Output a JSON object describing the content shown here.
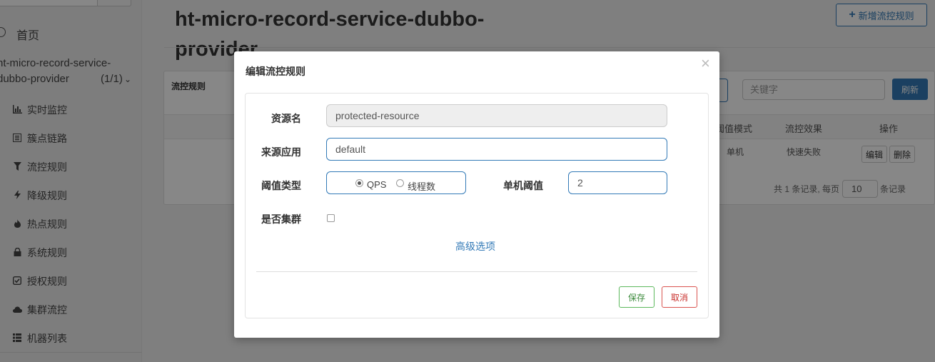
{
  "sidebar": {
    "home_label": "首页",
    "app_name_line1": "ht-micro-record-service-",
    "app_name_line2": "dubbo-provider",
    "app_count": "(1/1)",
    "items": [
      {
        "label": "实时监控",
        "icon": "bar-chart-icon"
      },
      {
        "label": "簇点链路",
        "icon": "list-icon"
      },
      {
        "label": "流控规则",
        "icon": "filter-icon"
      },
      {
        "label": "降级规则",
        "icon": "flash-icon"
      },
      {
        "label": "热点规则",
        "icon": "fire-icon"
      },
      {
        "label": "系统规则",
        "icon": "lock-icon"
      },
      {
        "label": "授权规则",
        "icon": "check-icon"
      },
      {
        "label": "集群流控",
        "icon": "cloud-icon"
      },
      {
        "label": "机器列表",
        "icon": "grid-icon"
      }
    ]
  },
  "page": {
    "title": "ht-micro-record-service-dubbo-provider",
    "add_button": "新增流控规则"
  },
  "panel": {
    "title": "流控规则",
    "keyword_placeholder": "关键字",
    "refresh_button": "刷新",
    "columns": {
      "threshold_mode": "阈值模式",
      "effect": "流控效果",
      "actions": "操作"
    },
    "row": {
      "threshold_mode": "单机",
      "effect": "快速失败",
      "edit": "编辑",
      "delete": "删除"
    },
    "pager": {
      "prefix": "共 1 条记录, 每页",
      "page_size": "10",
      "suffix": "条记录"
    }
  },
  "modal": {
    "title": "编辑流控规则",
    "close": "×",
    "resource_label": "资源名",
    "resource_value": "protected-resource",
    "origin_label": "来源应用",
    "origin_value": "default",
    "grade_label": "阈值类型",
    "grade_options": [
      "QPS",
      "线程数"
    ],
    "grade_selected": "QPS",
    "count_label": "单机阈值",
    "count_value": "2",
    "cluster_label": "是否集群",
    "cluster_checked": false,
    "advanced_link": "高级选项",
    "save_button": "保存",
    "cancel_button": "取消"
  }
}
